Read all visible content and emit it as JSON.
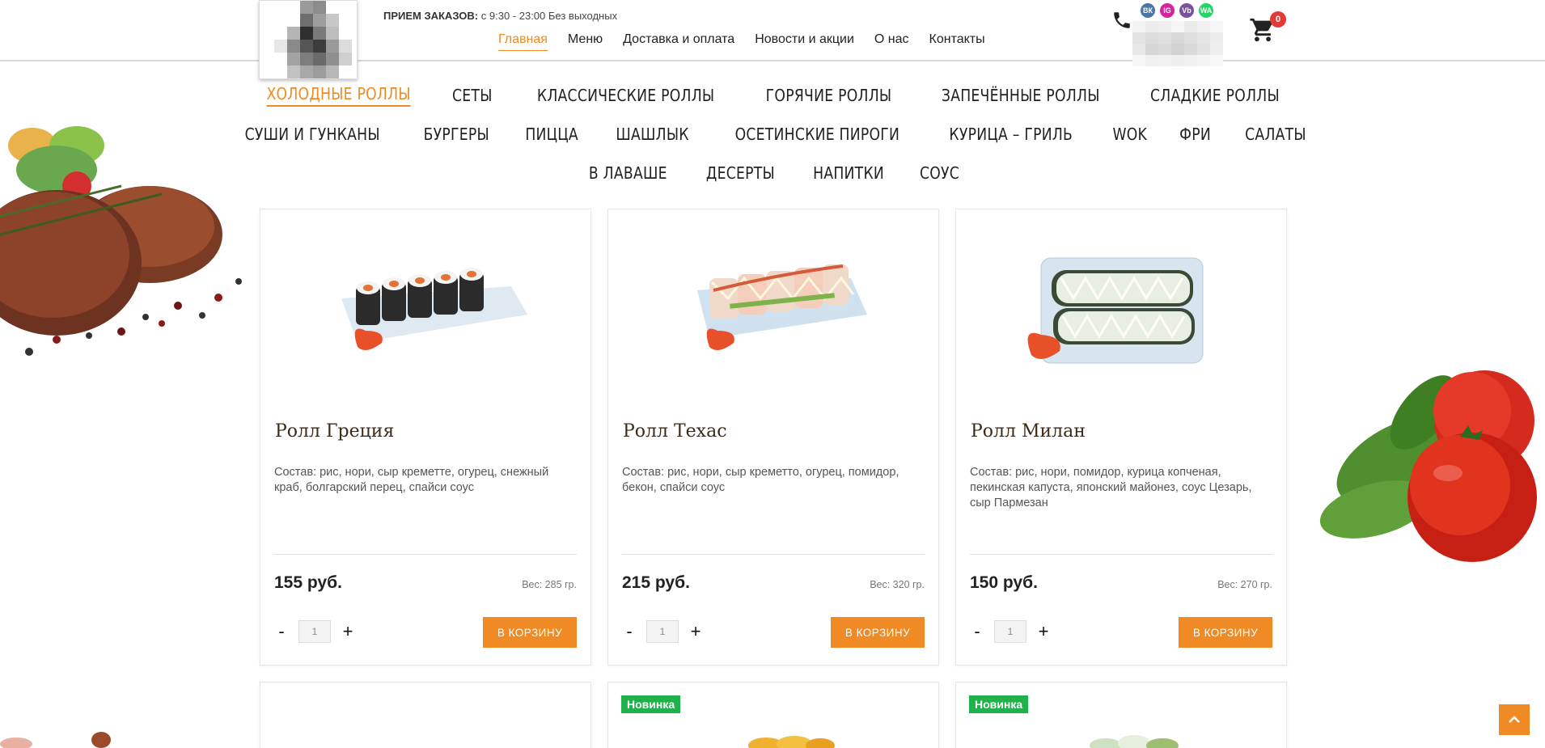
{
  "header": {
    "hours_label": "ПРИЕМ ЗАКАЗОВ:",
    "hours_value": "с 9:30 - 23:00 Без выходных",
    "nav": [
      {
        "label": "Главная",
        "active": true
      },
      {
        "label": "Меню"
      },
      {
        "label": "Доставка и оплата"
      },
      {
        "label": "Новости и акции"
      },
      {
        "label": "О нас"
      },
      {
        "label": "Контакты"
      }
    ],
    "socials": [
      "ВК",
      "IG",
      "Vb",
      "WA"
    ],
    "cart_count": "0",
    "icons": {
      "phone": "phone-icon",
      "cart": "cart-icon"
    }
  },
  "categories": {
    "row1": [
      "ХОЛОДНЫЕ РОЛЛЫ",
      "СЕТЫ",
      "КЛАССИЧЕСКИЕ РОЛЛЫ",
      "ГОРЯЧИЕ РОЛЛЫ",
      "ЗАПЕЧЁННЫЕ РОЛЛЫ",
      "СЛАДКИЕ РОЛЛЫ"
    ],
    "row2": [
      "СУШИ И ГУНКАНЫ",
      "БУРГЕРЫ",
      "ПИЦЦА",
      "ШАШЛЫК",
      "ОСЕТИНСКИЕ ПИРОГИ",
      "КУРИЦА – ГРИЛЬ",
      "WOK",
      "ФРИ",
      "САЛАТЫ"
    ],
    "row3": [
      "В ЛАВАШЕ",
      "ДЕСЕРТЫ",
      "НАПИТКИ",
      "СОУС"
    ],
    "active": "ХОЛОДНЫЕ РОЛЛЫ"
  },
  "products": [
    {
      "title": "Ролл Греция",
      "desc": "Состав: рис, нори, сыр креметте, огурец, снежный краб, болгарский перец, спайси соус",
      "price": "155 руб.",
      "weight": "Вес: 285 гр.",
      "qty": "1",
      "button": "В КОРЗИНУ"
    },
    {
      "title": "Ролл Техас",
      "desc": "Состав: рис, нори, сыр креметто, огурец, помидор, бекон, спайси соус",
      "price": "215 руб.",
      "weight": "Вес: 320 гр.",
      "qty": "1",
      "button": "В КОРЗИНУ"
    },
    {
      "title": "Ролл Милан",
      "desc": "Состав: рис, нори, помидор, курица копченая, пекинская капуста, японский майонез, соус Цезарь, сыр Пармезан",
      "price": "150 руб.",
      "weight": "Вес: 270 гр.",
      "qty": "1",
      "button": "В КОРЗИНУ"
    }
  ],
  "qty_controls": {
    "minus": "-",
    "plus": "+"
  },
  "next_row": {
    "badges": [
      "",
      "Новинка",
      "Новинка"
    ]
  },
  "colors": {
    "accent": "#f08a24",
    "badge_new": "#1fb14a",
    "cart_badge": "#e53935"
  }
}
